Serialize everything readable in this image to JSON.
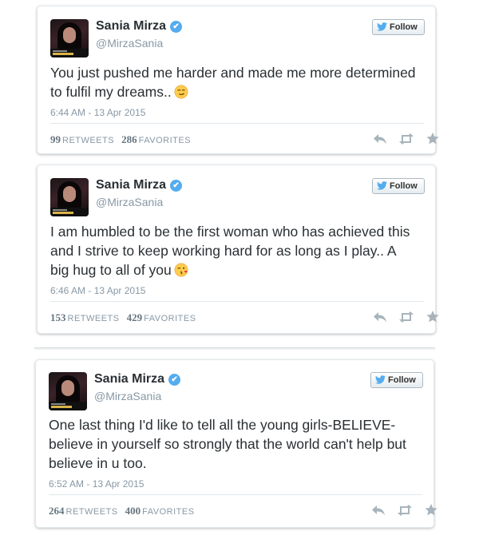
{
  "tweets": [
    {
      "name": "Sania Mirza",
      "handle": "@MirzaSania",
      "follow_label": "Follow",
      "text": "You just pushed me harder and made me more determined to fulfil my dreams..",
      "emoji_icon": "smirk-emoji",
      "time": "6:44 AM - 13 Apr 2015",
      "retweets": "99",
      "retweets_label": "RETWEETS",
      "favorites": "286",
      "favorites_label": "FAVORITES"
    },
    {
      "name": "Sania Mirza",
      "handle": "@MirzaSania",
      "follow_label": "Follow",
      "text": "I am humbled to be the first woman who has achieved this and I strive to keep working hard for as long as I play.. A big hug to all of you",
      "emoji_icon": "kiss-emoji",
      "time": "6:46 AM - 13 Apr 2015",
      "retweets": "153",
      "retweets_label": "RETWEETS",
      "favorites": "429",
      "favorites_label": "FAVORITES"
    },
    {
      "name": "Sania Mirza",
      "handle": "@MirzaSania",
      "follow_label": "Follow",
      "text": "One last thing I'd like to tell all the young girls-BELIEVE- believe in yourself so strongly that the world can't help but believe in u too.",
      "time": "6:52 AM - 13 Apr 2015",
      "retweets": "264",
      "retweets_label": "RETWEETS",
      "favorites": "400",
      "favorites_label": "FAVORITES"
    }
  ],
  "colors": {
    "twitter_blue": "#55acee",
    "text": "#292f33",
    "muted": "#8899a6",
    "border": "#e1e8ed"
  },
  "icons": [
    "verified-badge-icon",
    "twitter-bird-icon",
    "reply-icon",
    "retweet-icon",
    "favorite-star-icon"
  ]
}
